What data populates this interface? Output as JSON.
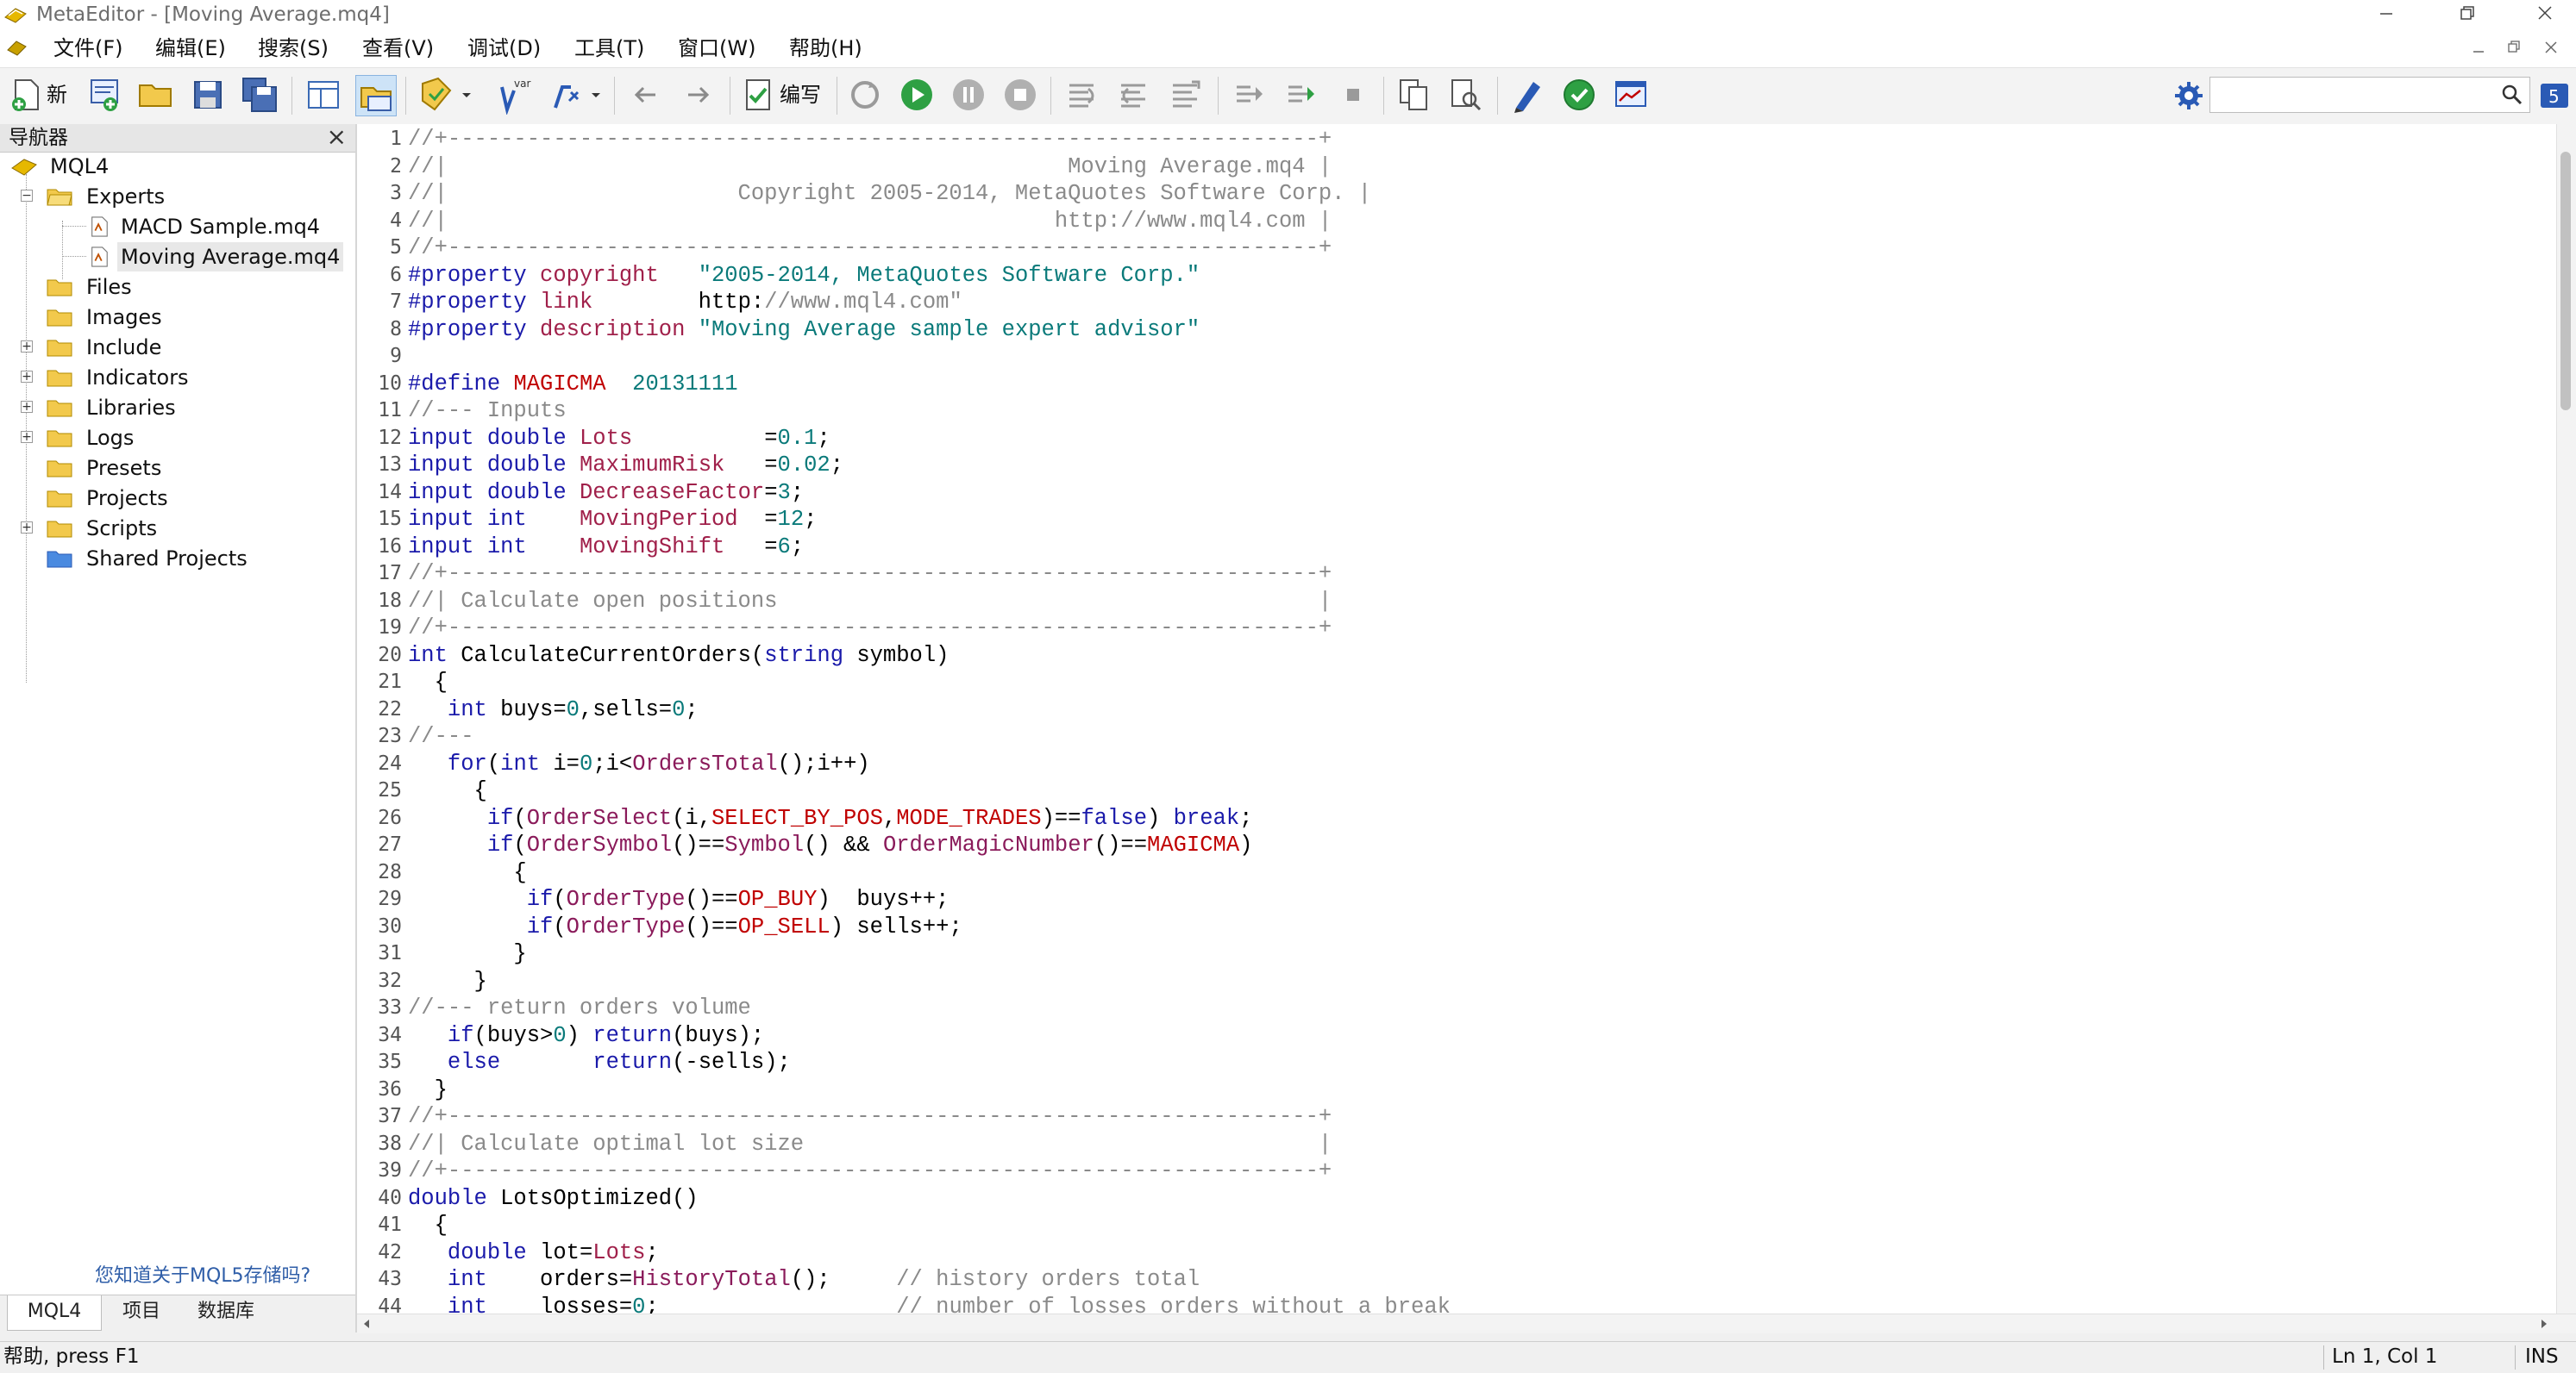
{
  "window": {
    "title": "MetaEditor - [Moving Average.mq4]"
  },
  "menu": {
    "items": [
      "文件(F)",
      "编辑(E)",
      "搜索(S)",
      "查看(V)",
      "调试(D)",
      "工具(T)",
      "窗口(W)",
      "帮助(H)"
    ]
  },
  "toolbar": {
    "new_label": "新",
    "var_label": "var",
    "compile_label": "编写",
    "search_placeholder": ""
  },
  "navigator": {
    "title": "导航器",
    "close": "×",
    "root": "MQL4",
    "items": [
      {
        "label": "Experts",
        "expanded": true
      },
      {
        "label": "MACD Sample.mq4"
      },
      {
        "label": "Moving Average.mq4"
      },
      {
        "label": "Files"
      },
      {
        "label": "Images"
      },
      {
        "label": "Include"
      },
      {
        "label": "Indicators"
      },
      {
        "label": "Libraries"
      },
      {
        "label": "Logs"
      },
      {
        "label": "Presets"
      },
      {
        "label": "Projects"
      },
      {
        "label": "Scripts"
      },
      {
        "label": "Shared Projects"
      }
    ],
    "promo_link": "您知道关于MQL5存储吗?",
    "tabs": [
      "MQL4",
      "项目",
      "数据库"
    ]
  },
  "editor": {
    "line_numbers": [
      "1",
      "2",
      "3",
      "4",
      "5",
      "6",
      "7",
      "8",
      "9",
      "10",
      "11",
      "12",
      "13",
      "14",
      "15",
      "16",
      "17",
      "18",
      "19",
      "20",
      "21",
      "22",
      "23",
      "24",
      "25",
      "26",
      "27",
      "28",
      "29",
      "30",
      "31",
      "32",
      "33",
      "34",
      "35",
      "36",
      "37",
      "38",
      "39",
      "40",
      "41",
      "42",
      "43",
      "44"
    ],
    "lines": [
      "//+------------------------------------------------------------------+",
      "//|                                               Moving Average.mq4 |",
      "//|                      Copyright 2005-2014, MetaQuotes Software Corp. |",
      "//|                                              http://www.mql4.com |",
      "//+------------------------------------------------------------------+",
      "#property copyright   \"2005-2014, MetaQuotes Software Corp.\"",
      "#property link        \"http://www.mql4.com\"",
      "#property description \"Moving Average sample expert advisor\"",
      "",
      "#define MAGICMA  20131111",
      "//--- Inputs",
      "input double Lots          =0.1;",
      "input double MaximumRisk   =0.02;",
      "input double DecreaseFactor=3;",
      "input int    MovingPeriod  =12;",
      "input int    MovingShift   =6;",
      "//+------------------------------------------------------------------+",
      "//| Calculate open positions                                         |",
      "//+------------------------------------------------------------------+",
      "int CalculateCurrentOrders(string symbol)",
      "  {",
      "   int buys=0,sells=0;",
      "//---",
      "   for(int i=0;i<OrdersTotal();i++)",
      "     {",
      "      if(OrderSelect(i,SELECT_BY_POS,MODE_TRADES)==false) break;",
      "      if(OrderSymbol()==Symbol() && OrderMagicNumber()==MAGICMA)",
      "        {",
      "         if(OrderType()==OP_BUY)  buys++;",
      "         if(OrderType()==OP_SELL) sells++;",
      "        }",
      "     }",
      "//--- return orders volume",
      "   if(buys>0) return(buys);",
      "   else       return(-sells);",
      "  }",
      "//+------------------------------------------------------------------+",
      "//| Calculate optimal lot size                                       |",
      "//+------------------------------------------------------------------+",
      "double LotsOptimized()",
      "  {",
      "   double lot=Lots;",
      "   int    orders=HistoryTotal();     // history orders total",
      "   int    losses=0;                  // number of losses orders without a break"
    ]
  },
  "status": {
    "help": "帮助, press F1",
    "position": "Ln 1, Col 1",
    "mode": "INS"
  },
  "colors": {
    "comment": "#8a8a8a",
    "keyword": "#1a1aaa",
    "identifier": "#a0204a",
    "string": "#0a7a7a",
    "constant": "#c00000"
  }
}
